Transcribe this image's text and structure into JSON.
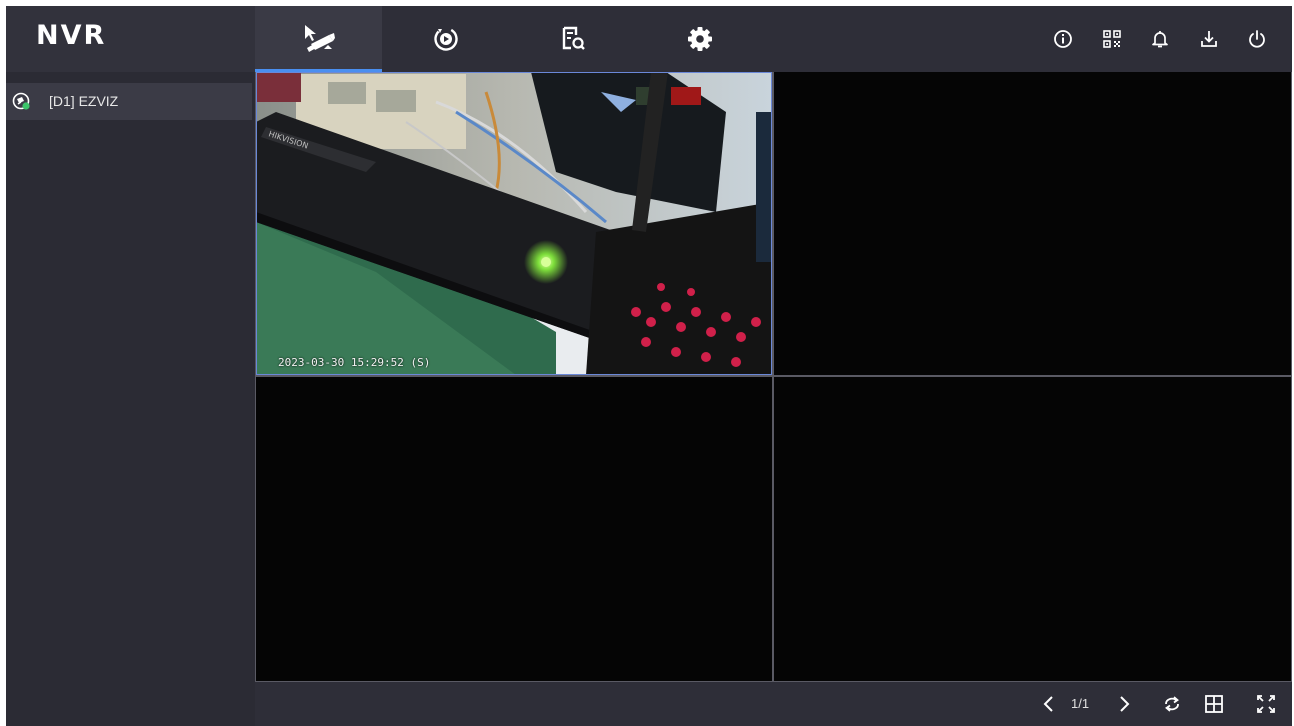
{
  "app": {
    "logo": "NVR"
  },
  "nav": {
    "tabs": [
      {
        "name": "live-view",
        "icon": "camera-live-icon",
        "active": true
      },
      {
        "name": "playback",
        "icon": "playback-icon",
        "active": false
      },
      {
        "name": "file-search",
        "icon": "file-search-icon",
        "active": false
      },
      {
        "name": "settings",
        "icon": "gear-icon",
        "active": false
      }
    ],
    "right_icons": [
      "info-icon",
      "qr-code-icon",
      "bell-icon",
      "download-icon",
      "power-icon"
    ]
  },
  "sidebar": {
    "devices": [
      {
        "label": "[D1] EZVIZ",
        "icon": "camera-online-icon"
      }
    ]
  },
  "live": {
    "layout": "2x2",
    "panes": [
      {
        "channel": 1,
        "has_video": true,
        "osd_time": "2023-03-30 15:29:52 (S)"
      },
      {
        "channel": 2,
        "has_video": false
      },
      {
        "channel": 3,
        "has_video": false
      },
      {
        "channel": 4,
        "has_video": false
      }
    ]
  },
  "bottombar": {
    "page_indicator": "1/1"
  },
  "colors": {
    "accent": "#4a8ff0",
    "selected_border": "#6a88d8",
    "online": "#3cc46a"
  }
}
